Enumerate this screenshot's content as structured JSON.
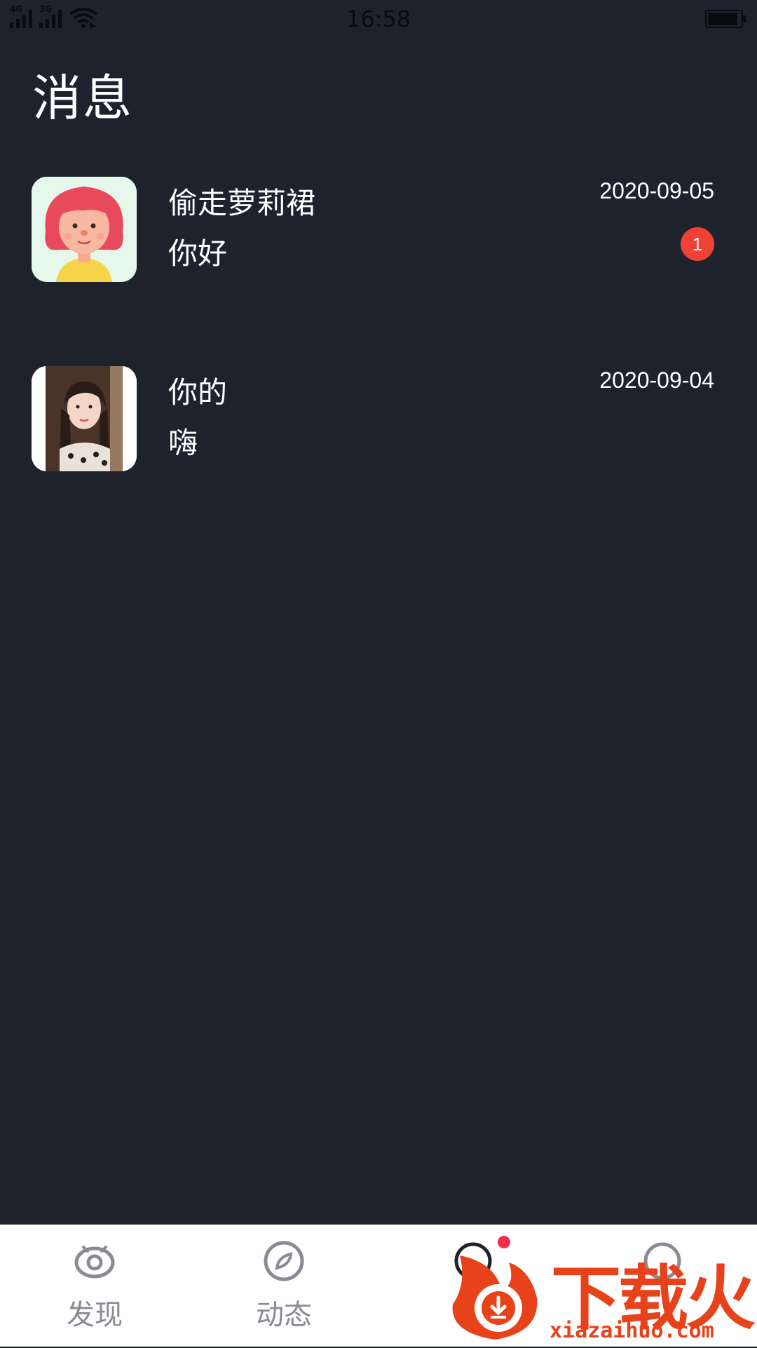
{
  "status_bar": {
    "time": "16:58",
    "net1": "4G",
    "net2": "3G"
  },
  "header": {
    "title": "消息"
  },
  "messages": [
    {
      "name": "偷走萝莉裙",
      "preview": "你好",
      "date": "2020-09-05",
      "unread": "1"
    },
    {
      "name": "你的",
      "preview": "嗨",
      "date": "2020-09-04"
    }
  ],
  "nav": {
    "discover": "发现",
    "feed": "动态"
  },
  "watermark": {
    "brand": "下载火",
    "url": "xiazaihuo.com"
  },
  "colors": {
    "background": "#1e222d",
    "badge": "#ef4136",
    "nav_bg": "#ffffff",
    "nav_label": "#8a8a94",
    "watermark": "#e8421a"
  }
}
